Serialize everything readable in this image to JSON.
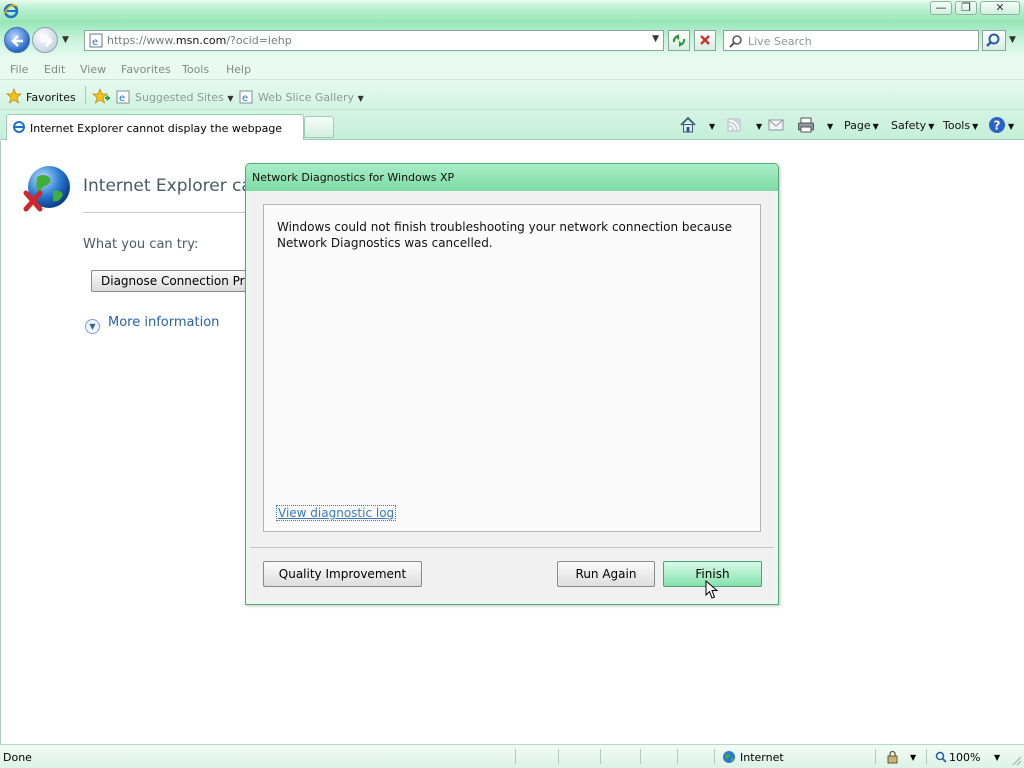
{
  "window": {
    "minimize_label": "—",
    "maximize_label": "❐",
    "close_label": "✕"
  },
  "address": {
    "url_prefix": "https://www.",
    "url_domain": "msn.com",
    "url_suffix": "/?ocid=iehp",
    "search_placeholder": "Live Search"
  },
  "menu": {
    "file": "File",
    "edit": "Edit",
    "view": "View",
    "favorites": "Favorites",
    "tools": "Tools",
    "help": "Help"
  },
  "favbar": {
    "favorites": "Favorites",
    "suggested_sites": "Suggested Sites",
    "web_slice_gallery": "Web Slice Gallery"
  },
  "tab": {
    "title": "Internet Explorer cannot display the webpage"
  },
  "commandbar": {
    "page": "Page",
    "safety": "Safety",
    "tools": "Tools"
  },
  "page": {
    "title": "Internet Explorer can",
    "what_you_can_try": "What you can try:",
    "diagnose_button": "Diagnose Connection Pro",
    "more_information": "More information"
  },
  "dialog": {
    "title": "Network Diagnostics for Windows XP",
    "message": "Windows could not finish troubleshooting your network connection because Network Diagnostics was cancelled.",
    "view_log_link": "View diagnostic log",
    "quality_button": "Quality Improvement",
    "run_again_button": "Run Again",
    "finish_button": "Finish"
  },
  "status": {
    "text": "Done",
    "zone": "Internet",
    "zoom": "100%"
  },
  "colors": {
    "chrome_green": "#98e6b8",
    "link_blue": "#3a7ab8",
    "dialog_border": "#56a87a"
  }
}
